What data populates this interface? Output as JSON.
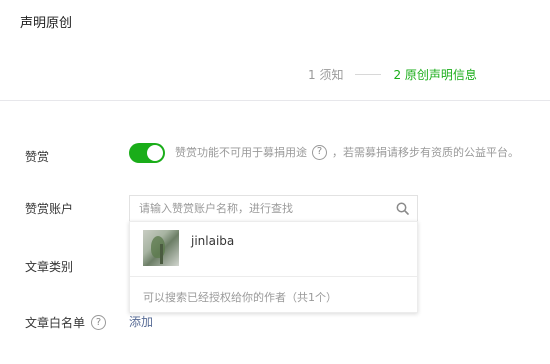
{
  "page": {
    "title": "声明原创"
  },
  "steps": [
    {
      "label": "1 须知"
    },
    {
      "label": "2 原创声明信息"
    }
  ],
  "reward": {
    "label": "赞赏",
    "enabled": true,
    "note_before": "赞赏功能不可用于募捐用途",
    "note_after": "，若需募捐请移步有资质的公益平台。"
  },
  "account": {
    "label": "赞赏账户",
    "search_placeholder": "请输入赞赏账户名称，进行查找",
    "results": [
      {
        "name": "jinlaiba"
      }
    ],
    "footer": "可以搜索已经授权给你的作者（共1个）"
  },
  "category": {
    "label": "文章类别"
  },
  "whitelist": {
    "label": "文章白名单",
    "add_label": "添加"
  },
  "help_glyph": "?",
  "colors": {
    "accent": "#1aad19",
    "link": "#576b95",
    "muted": "#9a9a9a"
  }
}
